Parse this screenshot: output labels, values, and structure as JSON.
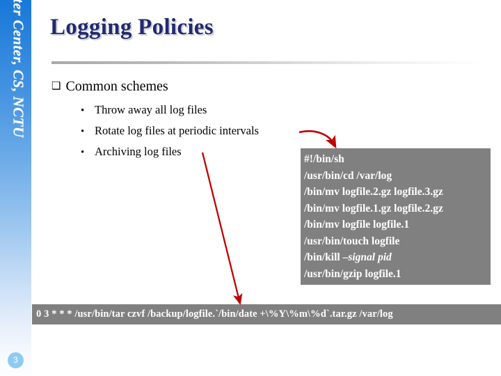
{
  "sidebar": {
    "branding": "Computer Center, CS, NCTU",
    "page_number": "3",
    "accent_top": "#1878d8",
    "accent_bottom": "#fdfeff"
  },
  "slide": {
    "title": "Logging Policies",
    "title_color": "#222a6e"
  },
  "content": {
    "level1_bullet_glyph": "❑",
    "level1_text": "Common schemes",
    "sub_bullet_glyph": "•",
    "sub_bullets": [
      "Throw away all log files",
      "Rotate log files at periodic intervals",
      "Archiving log files"
    ]
  },
  "code_box": {
    "background": "#808080",
    "text_color": "#ffffff",
    "lines": [
      "#!/bin/sh",
      "/usr/bin/cd /var/log",
      "/bin/mv logfile.2.gz logfile.3.gz",
      "/bin/mv logfile.1.gz logfile.2.gz",
      "/bin/mv logfile logfile.1",
      "/usr/bin/touch logfile",
      "/bin/kill ",
      "/usr/bin/gzip logfile.1"
    ],
    "kill_args_italic": "–signal pid"
  },
  "cron_bar": {
    "background": "#808080",
    "text_color": "#ffffff",
    "command": "0 3 * * *  /usr/bin/tar czvf /backup/logfile.`/bin/date +\\%Y\\%m\\%d`.tar.gz /var/log"
  },
  "annotations": {
    "arrow_color": "#c00000",
    "curved_arrow_label": "rotate-to-script-arrow",
    "straight_arrow_label": "archive-to-cron-arrow"
  }
}
